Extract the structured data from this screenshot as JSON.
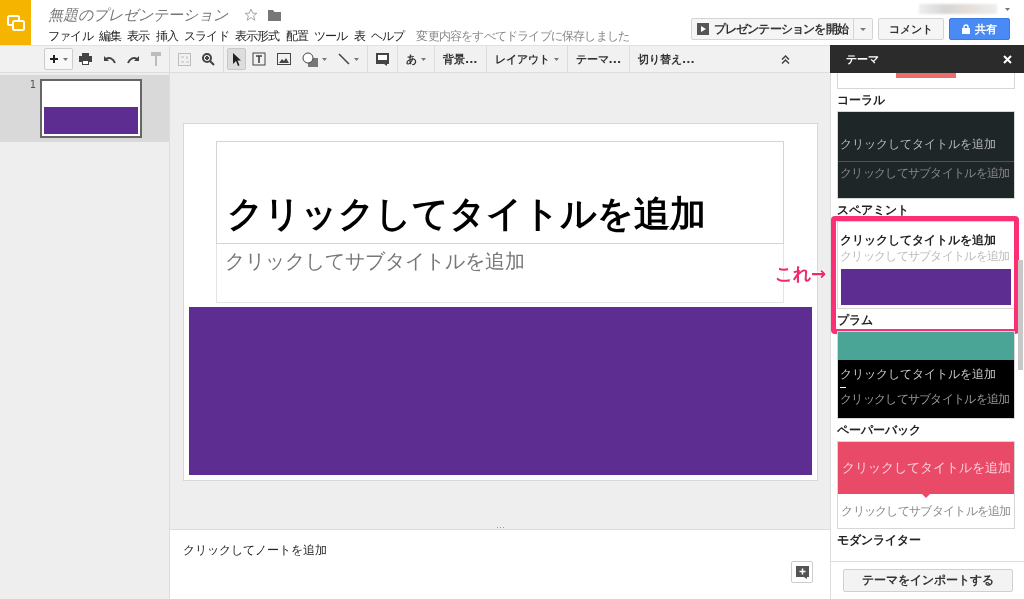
{
  "app": {
    "title": "無題のプレゼンテーション",
    "save_status": "変更内容をすべてドライブに保存しました"
  },
  "menus": [
    "ファイル",
    "編集",
    "表示",
    "挿入",
    "スライド",
    "表示形式",
    "配置",
    "ツール",
    "表",
    "ヘルプ"
  ],
  "header_buttons": {
    "present": "プレゼンテーションを開始",
    "comment": "コメント",
    "share": "共有"
  },
  "toolbar": [
    {
      "kind": "new-slide",
      "has_menu": true,
      "disabled": false
    },
    {
      "kind": "print",
      "disabled": false
    },
    {
      "kind": "undo",
      "disabled": false
    },
    {
      "kind": "redo",
      "disabled": false
    },
    {
      "kind": "paint-format",
      "disabled": true
    },
    {
      "kind": "separator"
    },
    {
      "kind": "select-layout",
      "disabled": true
    },
    {
      "kind": "zoom",
      "disabled": false
    },
    {
      "kind": "separator"
    },
    {
      "kind": "pointer",
      "selected": true
    },
    {
      "kind": "textbox",
      "selected": false
    },
    {
      "kind": "image",
      "selected": false
    },
    {
      "kind": "shape",
      "selected": false,
      "has_menu": true
    },
    {
      "kind": "line",
      "selected": false,
      "has_menu": true
    },
    {
      "kind": "separator"
    },
    {
      "kind": "comment",
      "disabled": false
    },
    {
      "kind": "separator"
    },
    {
      "kind": "text",
      "label": "あ",
      "has_menu": true
    },
    {
      "kind": "separator"
    },
    {
      "kind": "text",
      "label": "背景...",
      "has_menu": false
    },
    {
      "kind": "separator"
    },
    {
      "kind": "text",
      "label": "レイアウト",
      "has_menu": true
    },
    {
      "kind": "separator"
    },
    {
      "kind": "text",
      "label": "テーマ...",
      "has_menu": false
    },
    {
      "kind": "separator"
    },
    {
      "kind": "text",
      "label": "切り替え...",
      "has_menu": false
    }
  ],
  "filmstrip": [
    {
      "number": "1",
      "selected": true
    }
  ],
  "slide": {
    "title": "クリックしてタイトルを追加",
    "subtitle": "クリックしてサブタイトルを追加"
  },
  "notes": {
    "placeholder": "クリックしてノートを追加"
  },
  "theme_panel": {
    "title": "テーマ",
    "import_button": "テーマをインポートする",
    "themes": [
      {
        "name": "コーラル",
        "kind": "coral",
        "highlighted": false
      },
      {
        "name": "スペアミント",
        "kind": "spearmint",
        "highlighted": false,
        "title": "クリックしてタイトルを追加",
        "subtitle": "クリックしてサブタイトルを追加"
      },
      {
        "name": "プラム",
        "kind": "plum",
        "highlighted": true,
        "title": "クリックしてタイトルを追加",
        "subtitle": "クリックしてサブタイトルを追加"
      },
      {
        "name": "ペーパーバック",
        "kind": "paperback",
        "highlighted": false,
        "title": "クリックしてタイトルを追加",
        "subtitle": "クリックしてサブタイトルを追加"
      },
      {
        "name": "モダンライター",
        "kind": "modern",
        "highlighted": false,
        "title": "クリックしてタイトルを追加",
        "subtitle": "クリックしてサブタイトルを追加"
      }
    ]
  },
  "annotation": {
    "label": "これ→"
  }
}
